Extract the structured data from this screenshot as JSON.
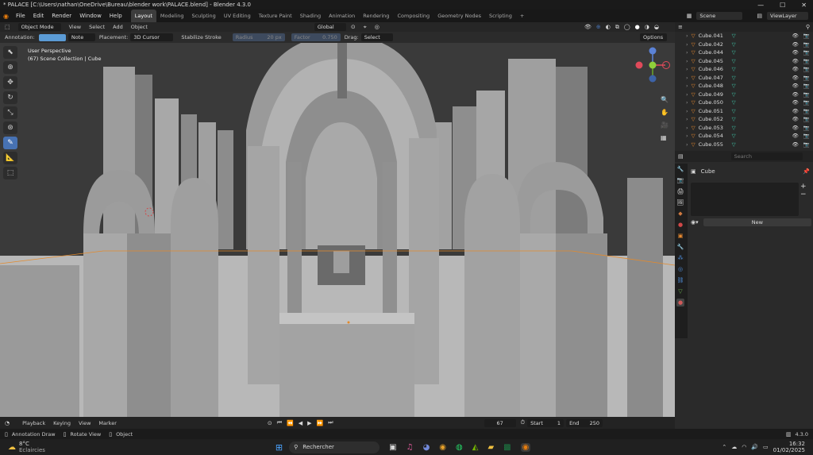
{
  "window": {
    "title": "* PALACE [C:\\Users\\nathan\\OneDrive\\Bureau\\blender work\\PALACE.blend] - Blender 4.3.0",
    "min": "—",
    "max": "☐",
    "close": "✕"
  },
  "menu": [
    "File",
    "Edit",
    "Render",
    "Window",
    "Help"
  ],
  "workspaces": [
    "Layout",
    "Modeling",
    "Sculpting",
    "UV Editing",
    "Texture Paint",
    "Shading",
    "Animation",
    "Rendering",
    "Compositing",
    "Geometry Nodes",
    "Scripting"
  ],
  "active_workspace": "Layout",
  "scene": {
    "label": "Scene",
    "viewlayer": "ViewLayer"
  },
  "vp_header": {
    "mode": "Object Mode",
    "items": [
      "View",
      "Select",
      "Add",
      "Object"
    ],
    "orientation": "Global"
  },
  "tool_header": {
    "annotation_label": "Annotation:",
    "annotation_color": "#5b9bd5",
    "note": "Note",
    "placement_label": "Placement:",
    "placement": "3D Cursor",
    "stabilize": "Stabilize Stroke",
    "radius_label": "Radius",
    "radius": "20 px",
    "factor_label": "Factor",
    "factor": "0.750",
    "drag_label": "Drag:",
    "drag": "Select Box",
    "options": "Options"
  },
  "vp_info": {
    "perspective": "User Perspective",
    "collection": "(67) Scene Collection | Cube"
  },
  "outliner": {
    "items": [
      "Cube.041",
      "Cube.042",
      "Cube.044",
      "Cube.045",
      "Cube.046",
      "Cube.047",
      "Cube.048",
      "Cube.049",
      "Cube.050",
      "Cube.051",
      "Cube.052",
      "Cube.053",
      "Cube.054",
      "Cube.055"
    ]
  },
  "props": {
    "search_placeholder": "Search",
    "object": "Cube",
    "new_btn": "New"
  },
  "timeline": {
    "playback": "Playback",
    "keying": "Keying",
    "view": "View",
    "marker": "Marker",
    "frame": "67",
    "start_label": "Start",
    "start": "1",
    "end_label": "End",
    "end": "250"
  },
  "status": {
    "a": "Annotation Draw",
    "b": "Rotate View",
    "c": "Object",
    "version": "4.3.0"
  },
  "taskbar": {
    "temp": "8°C",
    "weather": "Eclaircies",
    "search": "Rechercher",
    "time": "16:32",
    "date": "01/02/2025"
  }
}
